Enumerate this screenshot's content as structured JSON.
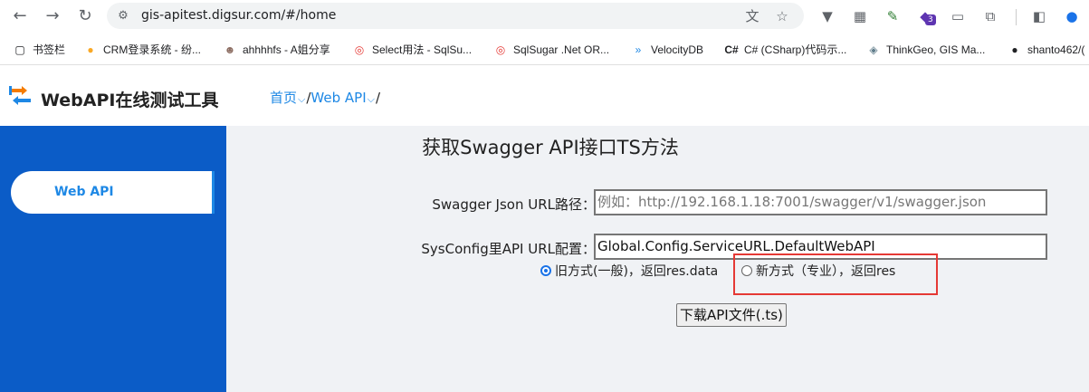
{
  "browser": {
    "url": "gis-apitest.digsur.com/#/home",
    "extension_badge": "3"
  },
  "bookmarks": [
    {
      "label": "书签栏",
      "icon": "folder-icon"
    },
    {
      "label": "CRM登录系统 - 纷...",
      "icon": "crm-icon"
    },
    {
      "label": "ahhhhfs - A姐分享",
      "icon": "ahhhhfs-icon"
    },
    {
      "label": "Select用法 - SqlSu...",
      "icon": "sqlsugar-icon"
    },
    {
      "label": "SqlSugar .Net OR...",
      "icon": "sqlsugar-icon"
    },
    {
      "label": "VelocityDB",
      "icon": "velocitydb-icon"
    },
    {
      "label": "C# (CSharp)代码示...",
      "icon": "csharp-icon"
    },
    {
      "label": "ThinkGeo, GIS Ma...",
      "icon": "thinkgeo-icon"
    },
    {
      "label": "shanto462/(",
      "icon": "github-icon"
    }
  ],
  "app": {
    "title": "WebAPI在线测试工具",
    "breadcrumb": {
      "home": "首页",
      "sep": "/",
      "section": "Web API",
      "end": "/"
    }
  },
  "sidebar": {
    "items": [
      {
        "label": "Web API",
        "active": true
      }
    ]
  },
  "main": {
    "title": "获取Swagger API接口TS方法",
    "swagger_label": "Swagger Json URL路径：",
    "swagger_placeholder": "例如：http://192.168.1.18:7001/swagger/v1/swagger.json",
    "sysconfig_label": "SysConfig里API URL配置：",
    "sysconfig_value": "Global.Config.ServiceURL.DefaultWebAPI",
    "radio_old": "旧方式(一般)，返回res.data",
    "radio_new": "新方式（专业），返回res",
    "download_button": "下载API文件(.ts)"
  },
  "colors": {
    "sidebar": "#0b5cc7",
    "accent": "#1e88e5",
    "highlight": "#e53935"
  }
}
